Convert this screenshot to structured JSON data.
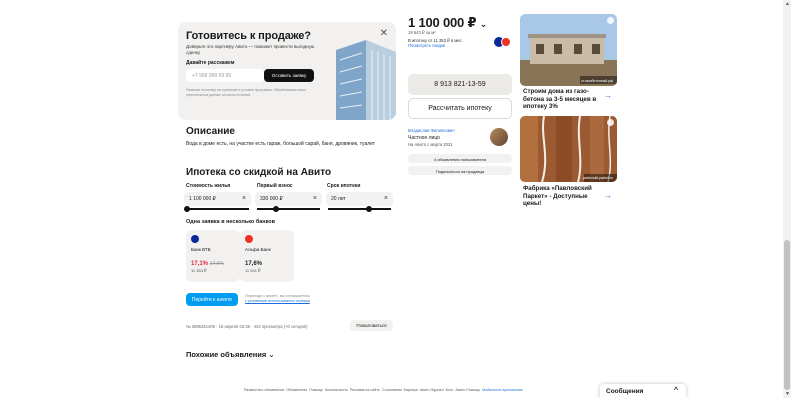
{
  "promo": {
    "title": "Готовитесь к продаже?",
    "subtitle": "Доверьте это партнёру Авито — поможет провести выгодную сделку",
    "form_label": "Давайте расскажем",
    "phone_placeholder": "+7 999 999 99 99",
    "submit_label": "Оставить заявку",
    "legal": "Нажимая на кнопку, вы принимаете условия программы. Обрабатываем ваши персональные данные согласно политике",
    "close_icon": "close-icon"
  },
  "description": {
    "heading": "Описание",
    "text": "Вода в доме есть, на участке есть гараж, большой сарай, баня, дровяник, туалет"
  },
  "mortgage": {
    "heading": "Ипотека со скидкой на Авито",
    "price_label": "Стоимость жилья",
    "price_value": "1 100 000 ₽",
    "down_label": "Первый взнос",
    "down_value": "330 000 ₽",
    "term_label": "Срок ипотеки",
    "term_value": "20 лет",
    "slider_price_fill": 0.0,
    "slider_down_fill": 0.3,
    "slider_term_fill": 0.8,
    "banks_heading": "Одна заявка в несколько банков",
    "banks": [
      {
        "name": "Банк ВТБ",
        "rate": "17,1%",
        "rate_old": "17,6%",
        "payment": "11 353 ₽",
        "color": "#0a2896"
      },
      {
        "name": "Альфа-Банк",
        "rate": "17,6%",
        "rate_old": "",
        "payment": "11 541 ₽",
        "color": "#ef3124"
      }
    ],
    "go_label": "Перейти к анкете",
    "consent_text": "Переходя к анкете, вы соглашаетесь",
    "consent_link": "с условиями использования сервиса"
  },
  "meta": {
    "text": "№ 3696341409 · 18 апреля 03:36 · 434 просмотра (+0 сегодня)",
    "complain_label": "Пожаловаться"
  },
  "similar": {
    "label": "Похожие объявления"
  },
  "seller_panel": {
    "price": "1 100 000 ₽",
    "per_meter": "19 643 ₽ за м²",
    "mortgage_line": "В ипотеку от 11 353 ₽ в мес.",
    "mortgage_link": "Посмотреть скидки",
    "phone": "8 913 821-13-59",
    "calc_label": "Рассчитать ипотеку",
    "seller_name": "Владислав Филиппович",
    "seller_type": "Частное лицо",
    "seller_since": "На Авито с марта 2021",
    "all_ads_label": "4 объявления пользователя",
    "subscribe_label": "Подписаться на продавца"
  },
  "ads": [
    {
      "title": "Строим дома из газо-бетона за 3-5 месяцев в ипотеку 3%",
      "brand": "ст.газобетонный.рф"
    },
    {
      "title": "Фабрика «Павловский Паркет» - Доступные цены!",
      "brand": "pavlovskii-parket.ru"
    }
  ],
  "footer": {
    "links": [
      "Разместить объявление",
      "Объявления",
      "Помощь",
      "Безопасность",
      "Реклама на сайте",
      "О компании",
      "Карьера",
      "Авито Журнал",
      "Блог",
      "Авито Помощь"
    ],
    "mobile_label": "Мобильное приложение"
  },
  "messages": {
    "label": "Сообщения"
  },
  "colors": {
    "accent": "#009cf0",
    "link": "#1a6ed8"
  }
}
